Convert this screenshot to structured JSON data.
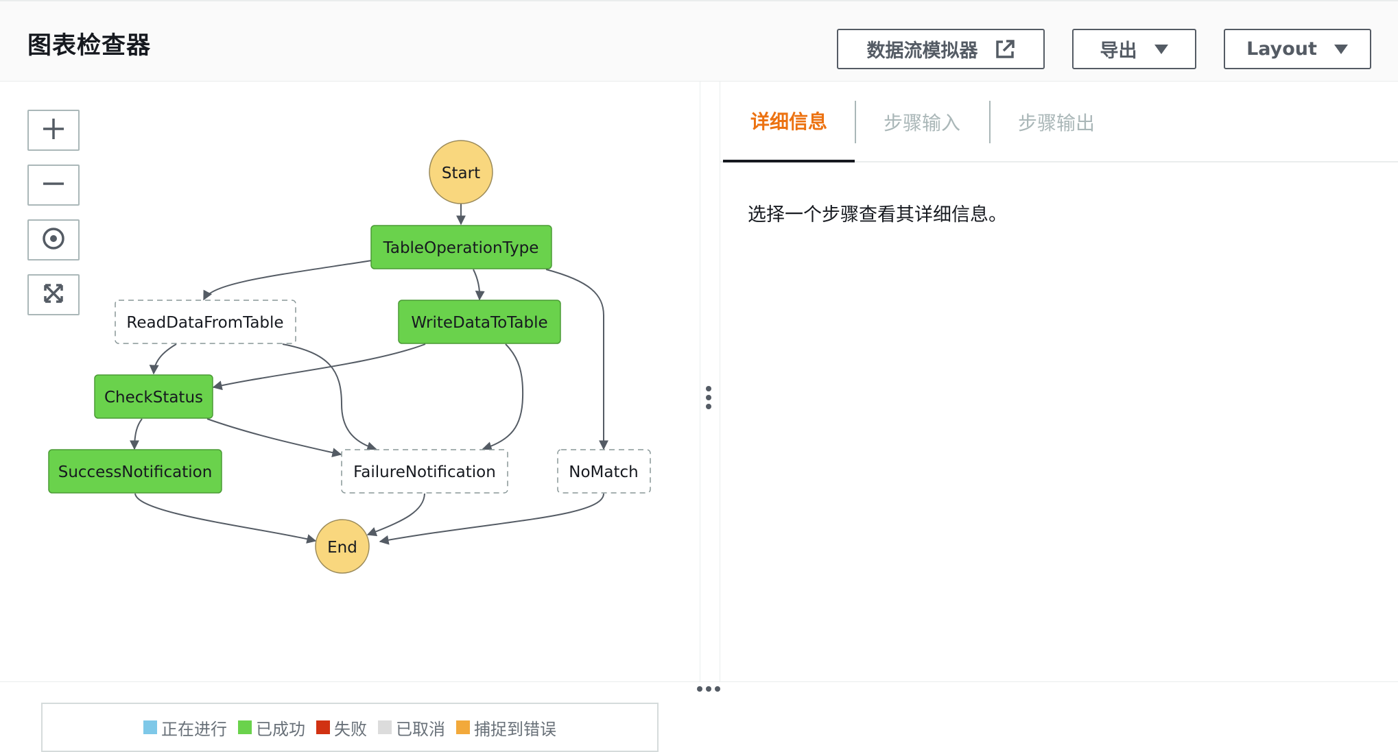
{
  "header": {
    "title": "图表检查器",
    "buttons": {
      "simulator": {
        "label": "数据流模拟器",
        "icon": "external-link-icon"
      },
      "export": {
        "label": "导出",
        "icon": "caret-down-icon"
      },
      "layout": {
        "label": "Layout",
        "icon": "caret-down-icon"
      }
    }
  },
  "zoom_controls": [
    {
      "name": "zoom-in",
      "icon": "plus-icon"
    },
    {
      "name": "zoom-out",
      "icon": "minus-icon"
    },
    {
      "name": "center",
      "icon": "target-icon"
    },
    {
      "name": "fit",
      "icon": "expand-icon"
    }
  ],
  "graph": {
    "colors": {
      "success": "#6ad24c",
      "terminal": "#f9d77e",
      "pending": "#ffffff",
      "edge": "#545b64"
    },
    "nodes": {
      "start": {
        "label": "Start",
        "status": "terminal"
      },
      "table_op": {
        "label": "TableOperationType",
        "status": "success"
      },
      "read": {
        "label": "ReadDataFromTable",
        "status": "not-run"
      },
      "write": {
        "label": "WriteDataToTable",
        "status": "success"
      },
      "check": {
        "label": "CheckStatus",
        "status": "success"
      },
      "success_notif": {
        "label": "SuccessNotification",
        "status": "success"
      },
      "failure_notif": {
        "label": "FailureNotification",
        "status": "not-run"
      },
      "nomatch": {
        "label": "NoMatch",
        "status": "not-run"
      },
      "end": {
        "label": "End",
        "status": "terminal"
      }
    }
  },
  "legend": [
    {
      "label": "正在进行",
      "color": "#7ec8e8"
    },
    {
      "label": "已成功",
      "color": "#6ad24c"
    },
    {
      "label": "失败",
      "color": "#d13212"
    },
    {
      "label": "已取消",
      "color": "#dcdcdc"
    },
    {
      "label": "捕捉到错误",
      "color": "#f2a93b"
    }
  ],
  "details": {
    "tabs": [
      {
        "label": "详细信息",
        "active": true
      },
      {
        "label": "步骤输入",
        "active": false
      },
      {
        "label": "步骤输出",
        "active": false
      }
    ],
    "placeholder": "选择一个步骤查看其详细信息。"
  }
}
